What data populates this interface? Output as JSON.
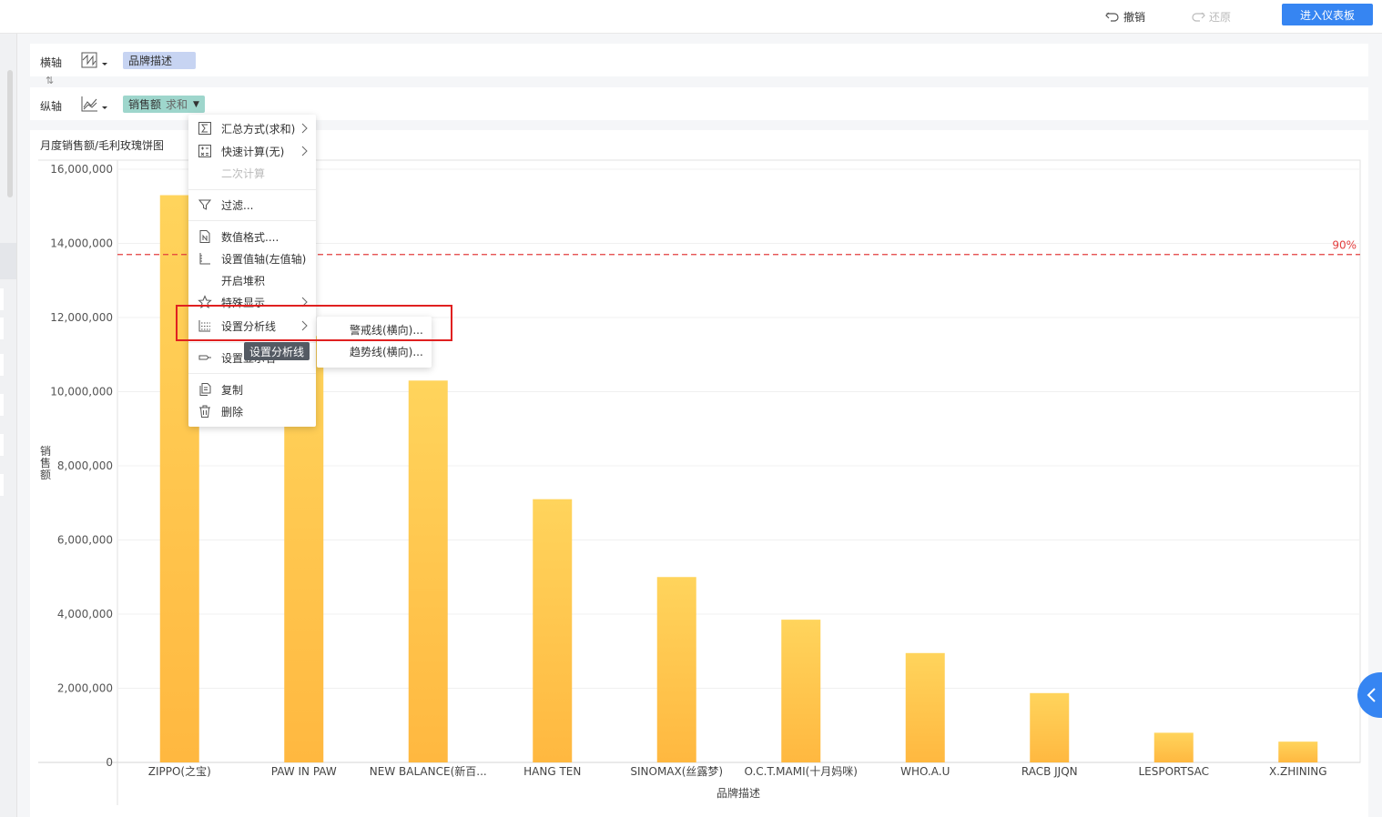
{
  "toolbar": {
    "undo_label": "撤销",
    "redo_label": "还原",
    "enter_dashboard_label": "进入仪表板"
  },
  "shelves": {
    "x_axis": {
      "label": "横轴",
      "field": "品牌描述"
    },
    "y_axis": {
      "label": "纵轴",
      "field": "销售额",
      "aggregation": "求和"
    }
  },
  "chart_title": "月度销售额/毛利玫瑰饼图",
  "context_menu": {
    "items": {
      "summary": "汇总方式(求和)",
      "quick_calc": "快速计算(无)",
      "secondary_calc": "二次计算",
      "filter": "过滤...",
      "number_format": "数值格式....",
      "set_value_axis": "设置值轴(左值轴)",
      "enable_stack": "开启堆积",
      "special_display": "特殊显示",
      "analysis_line": "设置分析线",
      "display_name": "设置显示名",
      "copy": "复制",
      "delete": "删除"
    },
    "submenu": [
      "警戒线(横向)...",
      "趋势线(横向)..."
    ],
    "tooltip": "设置分析线"
  },
  "chart_data": {
    "type": "bar",
    "categories": [
      "ZIPPO(之宝)",
      "PAW IN PAW",
      "NEW BALANCE(新百...",
      "HANG TEN",
      "SINOMAX(丝露梦)",
      "O.C.T.MAMI(十月妈咪)",
      "WHO.A.U",
      "RACB JJQN",
      "LESPORTSAC",
      "X.ZHINING"
    ],
    "values": [
      15300000,
      11500000,
      10300000,
      7100000,
      5000000,
      3850000,
      2950000,
      1870000,
      800000,
      560000
    ],
    "xlabel": "品牌描述",
    "ylabel": "销售额",
    "ylim": [
      0,
      16000000
    ],
    "yticks": [
      0,
      2000000,
      4000000,
      6000000,
      8000000,
      10000000,
      12000000,
      14000000,
      16000000
    ],
    "ytick_labels": [
      "0",
      "2,000,000",
      "4,000,000",
      "6,000,000",
      "8,000,000",
      "10,000,000",
      "12,000,000",
      "14,000,000",
      "16,000,000"
    ],
    "reference_line": {
      "value": 13700000,
      "label": "90%",
      "color": "#e33e3e"
    },
    "bar_color_top": "#ffd45c",
    "bar_color_bottom": "#ffb840",
    "grid": true
  },
  "colors": {
    "accent": "#3685f2",
    "highlight_box": "#e02020",
    "x_pill": "#c7d4f2",
    "y_pill": "#9ed6cc"
  }
}
